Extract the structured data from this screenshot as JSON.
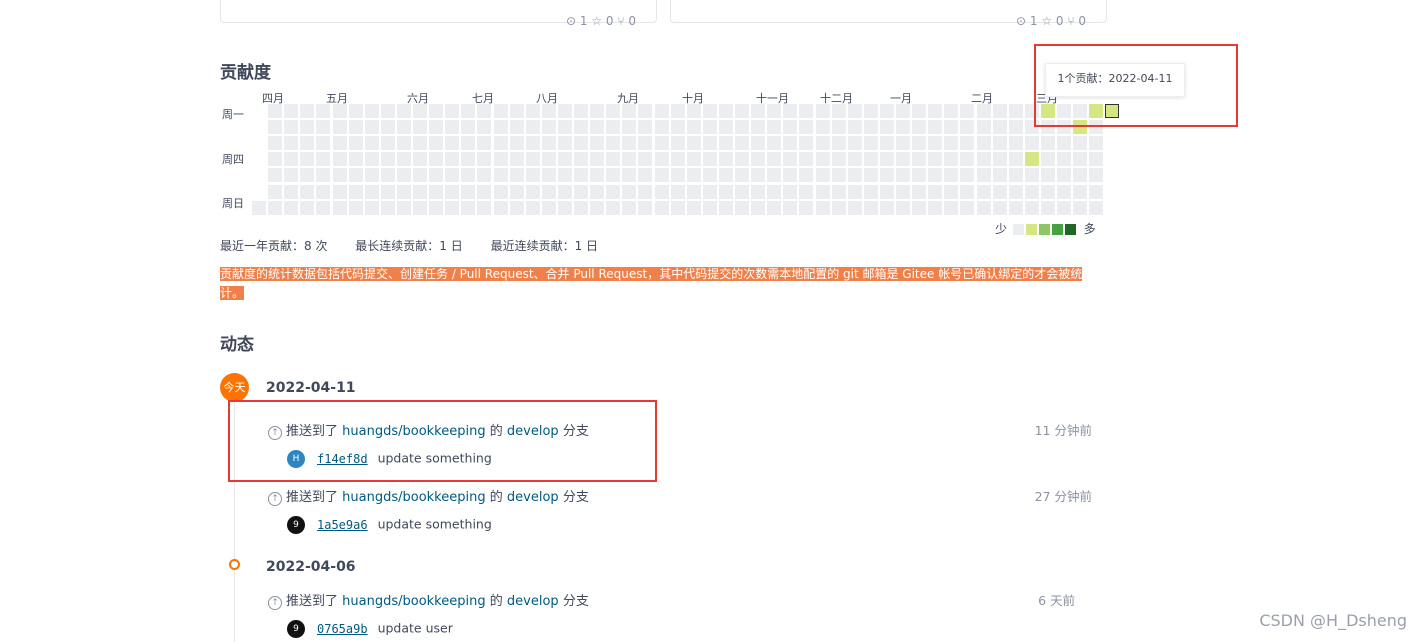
{
  "colors": {
    "empty": "#ebedf0",
    "level1": "#d6e685",
    "level2": "#8cc665",
    "level3": "#44a340",
    "level4": "#1e6823",
    "accent": "#fe7300",
    "link": "#005980",
    "highlight_box": "#e53935",
    "note_bg": "#f0804a"
  },
  "repo_cards": [
    {
      "meta": "⊙ 1  ☆ 0  ⑂ 0"
    },
    {
      "meta": "⊙ 1  ☆ 0  ⑂ 0"
    }
  ],
  "contributions": {
    "title": "贡献度",
    "months": [
      "四月",
      "五月",
      "六月",
      "七月",
      "八月",
      "九月",
      "十月",
      "十一月",
      "十二月",
      "一月",
      "二月",
      "三月"
    ],
    "weekdays": [
      "周一",
      "周四",
      "周日"
    ],
    "tooltip": "1个贡献：2022-04-11",
    "legend_less": "少",
    "legend_more": "多",
    "active_cells": [
      {
        "week": 48,
        "day": 3,
        "level": 1
      },
      {
        "week": 49,
        "day": 0,
        "level": 1
      },
      {
        "week": 51,
        "day": 1,
        "level": 1
      },
      {
        "week": 52,
        "day": 0,
        "level": 1
      },
      {
        "week": 53,
        "day": 0,
        "level": 1,
        "selected": true
      }
    ],
    "stats": {
      "year_total": "最近一年贡献：8 次",
      "longest_streak": "最长连续贡献：1 日",
      "current_streak": "最近连续贡献：1 日"
    },
    "note": "贡献度的统计数据包括代码提交、创建任务 / Pull Request、合并 Pull Request，其中代码提交的次数需本地配置的 git 邮箱是 Gitee 帐号已确认绑定的才会被统计。"
  },
  "activity": {
    "title": "动态",
    "today_badge": "今天",
    "groups": [
      {
        "date": "2022-04-11",
        "events": [
          {
            "prefix": "推送到了",
            "repo": "huangds/bookkeeping",
            "mid": "的",
            "branch": "develop",
            "suffix": "分支",
            "time": "11 分钟前",
            "avatar": "H",
            "avatar_color": "#2e86c1",
            "sha": "f14ef8d",
            "message": "update something"
          },
          {
            "prefix": "推送到了",
            "repo": "huangds/bookkeeping",
            "mid": "的",
            "branch": "develop",
            "suffix": "分支",
            "time": "27 分钟前",
            "avatar": "9",
            "avatar_color": "#111111",
            "sha": "1a5e9a6",
            "message": "update something"
          }
        ]
      },
      {
        "date": "2022-04-06",
        "events": [
          {
            "prefix": "推送到了",
            "repo": "huangds/bookkeeping",
            "mid": "的",
            "branch": "develop",
            "suffix": "分支",
            "time": "6 天前",
            "avatar": "9",
            "avatar_color": "#111111",
            "sha": "0765a9b",
            "message": "update user"
          }
        ]
      }
    ]
  },
  "watermark": "CSDN @H_Dsheng"
}
